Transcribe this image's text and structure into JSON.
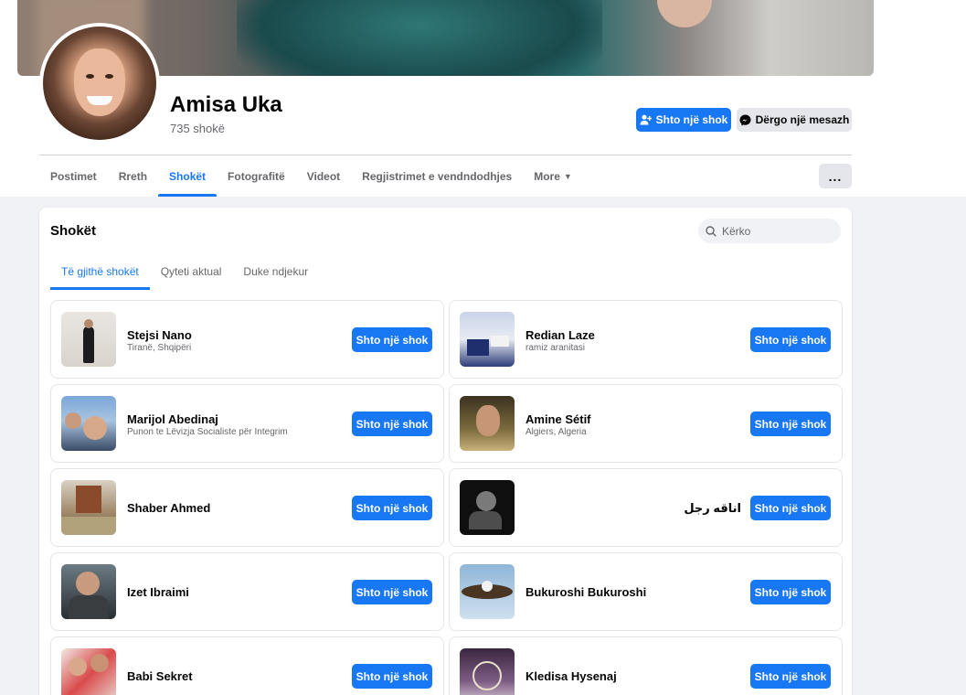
{
  "profile": {
    "name": "Amisa Uka",
    "friend_count": "735 shokë",
    "add_friend_label": "Shto një shok",
    "message_label": "Dërgo një mesazh"
  },
  "nav": {
    "tabs": [
      "Postimet",
      "Rreth",
      "Shokët",
      "Fotografitë",
      "Videot",
      "Regjistrimet e vendndodhjes",
      "More"
    ],
    "active_tab": "Shokët",
    "more_options": "..."
  },
  "friends_section": {
    "title": "Shokët",
    "search_placeholder": "Kërko",
    "subtabs": [
      "Të gjithë shokët",
      "Qyteti aktual",
      "Duke ndjekur"
    ],
    "active_subtab": "Të gjithë shokët",
    "add_button_label": "Shto një shok",
    "friends": [
      {
        "name": "Stejsi Nano",
        "subtitle": "Tiranë, Shqipëri"
      },
      {
        "name": "Redian Laze",
        "subtitle": "ramiz aranitasi"
      },
      {
        "name": "Marijol Abedinaj",
        "subtitle": "Punon te Lëvizja Socialiste për Integrim"
      },
      {
        "name": "Amine Sétif",
        "subtitle": "Algiers, Algeria"
      },
      {
        "name": "Shaber Ahmed",
        "subtitle": ""
      },
      {
        "name": "اناقه رجل",
        "subtitle": ""
      },
      {
        "name": "Izet Ibraimi",
        "subtitle": ""
      },
      {
        "name": "Bukuroshi Bukuroshi",
        "subtitle": ""
      },
      {
        "name": "Babi Sekret",
        "subtitle": ""
      },
      {
        "name": "Kledisa Hysenaj",
        "subtitle": ""
      }
    ]
  },
  "colors": {
    "accent": "#1877f2",
    "background": "#f0f2f5",
    "text_secondary": "#65676b"
  },
  "icons": {
    "add_friend": "person-plus-icon",
    "message": "messenger-icon",
    "search": "search-icon",
    "caret": "caret-down-icon"
  }
}
